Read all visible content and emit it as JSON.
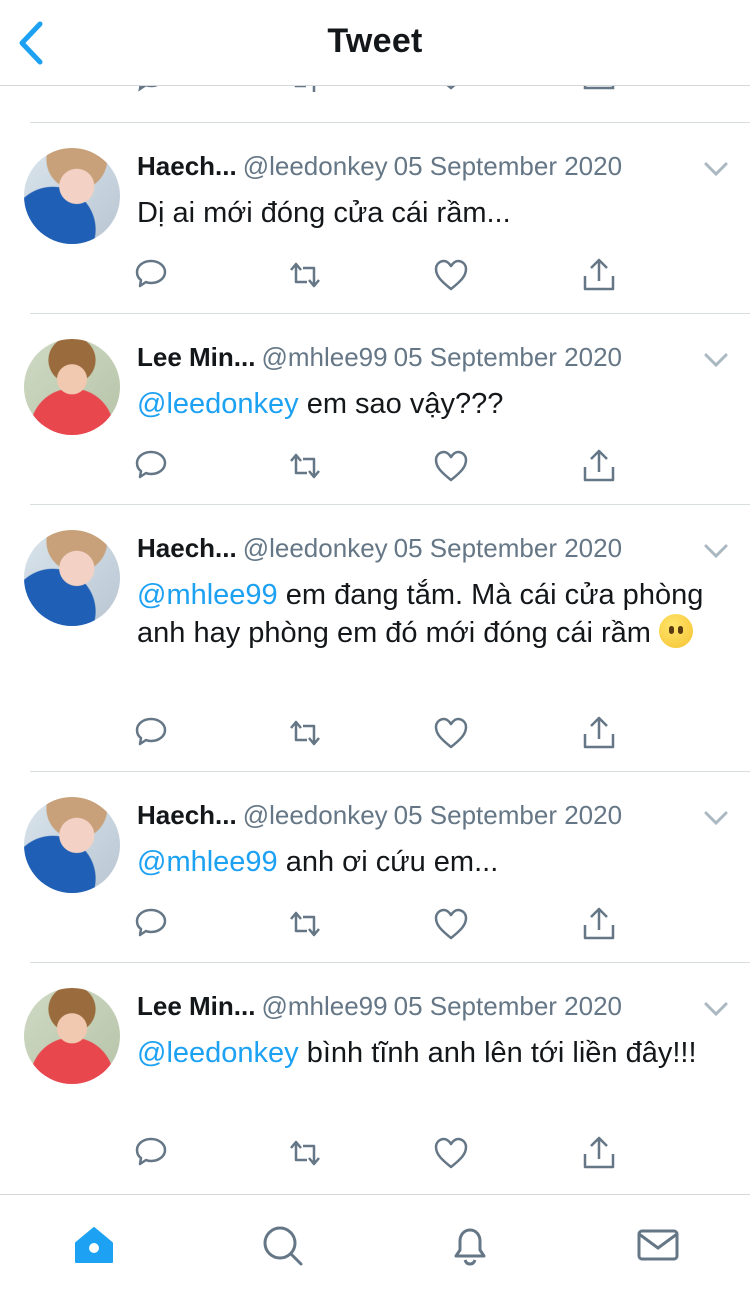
{
  "header": {
    "title": "Tweet"
  },
  "tweets": [
    {
      "avatar": "haechan",
      "name": "Haech...",
      "handle": "@leedonkey",
      "date": "05 September 2020",
      "mention": "",
      "text": "Dị ai mới đóng cửa cái rầm..."
    },
    {
      "avatar": "lee",
      "name": "Lee Min...",
      "handle": "@mhlee99",
      "date": "05 September 2020",
      "mention": "@leedonkey",
      "text": " em sao vậy???"
    },
    {
      "avatar": "haechan",
      "name": "Haech...",
      "handle": "@leedonkey",
      "date": "05 September 2020",
      "mention": "@mhlee99",
      "text": " em đang tắm. Mà cái cửa phòng anh hay phòng em đó mới đóng cái rầm"
    },
    {
      "avatar": "haechan",
      "name": "Haech...",
      "handle": "@leedonkey",
      "date": "05 September 2020",
      "mention": "@mhlee99",
      "text": " anh ơi cứu em..."
    },
    {
      "avatar": "lee",
      "name": "Lee Min...",
      "handle": "@mhlee99",
      "date": "05 September 2020",
      "mention": "@leedonkey",
      "text": " bình tĩnh anh lên tới liền đây!!!"
    }
  ],
  "emoji": {
    "name": "face-without-mouth"
  },
  "tabbar": {
    "items": [
      "home-icon",
      "search-icon",
      "bell-icon",
      "mail-icon"
    ],
    "active": "home-icon"
  },
  "colors": {
    "accent": "#1da1f2",
    "text": "#14171a",
    "secondary": "#657786",
    "icon": "#657786"
  }
}
